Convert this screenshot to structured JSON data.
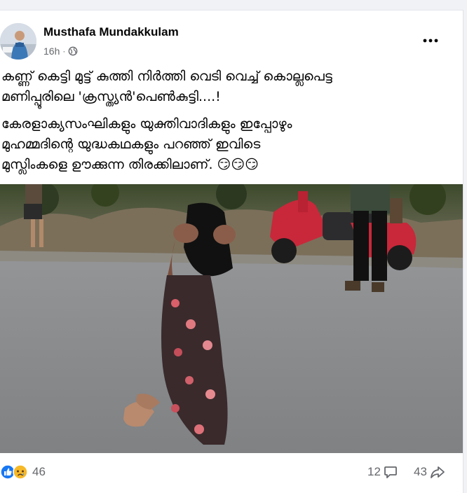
{
  "post": {
    "author": "Musthafa Mundakkulam",
    "time": "16h",
    "separator": "·",
    "paragraph1": "കണ്ണ് കെട്ടി മുട്ട് കുത്തി നിർത്തി വെടി വെച്ച് കൊല്ലപെട്ട\nമണിപ്പൂരിലെ 'ക്രസ്ത്യൻ'പെൺകുട്ടി....!",
    "paragraph2": "കേരളാക്യസംഘികളും യുക്തിവാദികളും ഇപ്പോഴും\nമുഹമ്മദിന്റെ യുദ്ധകഥകളും പറഞ്ഞ് ഇവിടെ\nമുസ്ലിംകളെ ഊക്കുന്ന തിരക്കിലാണ്. 😏😏😏"
  },
  "stats": {
    "reactions": "46",
    "comments": "12",
    "shares": "43"
  },
  "icons": {
    "audience": "globe-icon",
    "more": "more-options-icon",
    "like": "like-reaction-icon",
    "sad": "sad-reaction-icon",
    "comment": "comment-icon",
    "share": "share-icon"
  },
  "colors": {
    "like_blue": "#1877f2",
    "sad_yellow": "#f7b928",
    "meta_gray": "#65676b",
    "bike_red": "#c8283a"
  }
}
